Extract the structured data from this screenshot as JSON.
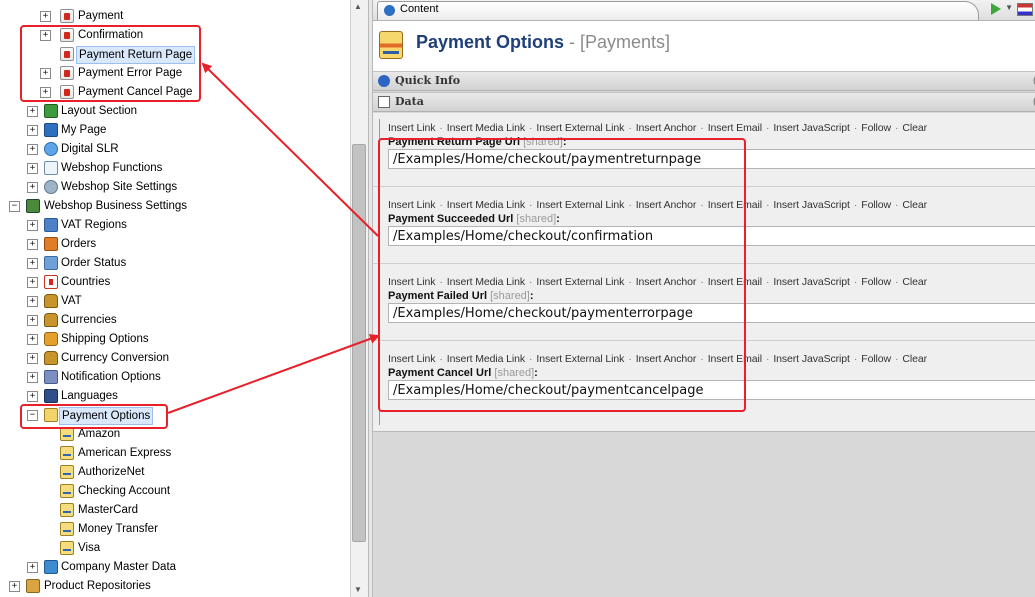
{
  "tree": {
    "items": [
      {
        "label": "Payment",
        "icon": "page-icon"
      },
      {
        "label": "Confirmation",
        "icon": "page-icon"
      },
      {
        "label": "Payment Return Page",
        "icon": "page-icon"
      },
      {
        "label": "Payment Error Page",
        "icon": "page-icon"
      },
      {
        "label": "Payment Cancel Page",
        "icon": "page-icon"
      },
      {
        "label": "Layout Section",
        "icon": "layout-icon"
      },
      {
        "label": "My Page",
        "icon": "grid-icon"
      },
      {
        "label": "Digital SLR",
        "icon": "camera-icon"
      },
      {
        "label": "Webshop Functions",
        "icon": "function-icon"
      },
      {
        "label": "Webshop Site Settings",
        "icon": "gear-icon"
      },
      {
        "label": "Webshop Business Settings",
        "icon": "business-icon"
      },
      {
        "label": "VAT Regions",
        "icon": "region-icon"
      },
      {
        "label": "Orders",
        "icon": "orders-icon"
      },
      {
        "label": "Order Status",
        "icon": "hourglass-icon"
      },
      {
        "label": "Countries",
        "icon": "flag-icon"
      },
      {
        "label": "VAT",
        "icon": "money-bag-icon"
      },
      {
        "label": "Currencies",
        "icon": "money-bag-icon"
      },
      {
        "label": "Shipping Options",
        "icon": "shipping-icon"
      },
      {
        "label": "Currency Conversion",
        "icon": "money-bag-icon"
      },
      {
        "label": "Notification Options",
        "icon": "notification-icon"
      },
      {
        "label": "Languages",
        "icon": "language-icon"
      },
      {
        "label": "Payment Options",
        "icon": "payment-icon"
      },
      {
        "label": "Amazon",
        "icon": "card-icon"
      },
      {
        "label": "American Express",
        "icon": "card-icon"
      },
      {
        "label": "AuthorizeNet",
        "icon": "card-icon"
      },
      {
        "label": "Checking Account",
        "icon": "card-icon"
      },
      {
        "label": "MasterCard",
        "icon": "card-icon"
      },
      {
        "label": "Money Transfer",
        "icon": "card-icon"
      },
      {
        "label": "Visa",
        "icon": "card-icon"
      },
      {
        "label": "Company Master Data",
        "icon": "company-icon"
      },
      {
        "label": "Product Repositories",
        "icon": "box-icon"
      }
    ]
  },
  "tab": {
    "label": "Content"
  },
  "header": {
    "title": "Payment Options",
    "subtitle": " - [Payments]"
  },
  "sections": {
    "quick_info": "Quick Info",
    "data": "Data"
  },
  "toolbar_links": [
    "Insert Link",
    "Insert Media Link",
    "Insert External Link",
    "Insert Anchor",
    "Insert Email",
    "Insert JavaScript",
    "Follow",
    "Clear"
  ],
  "fields": [
    {
      "label": "Payment Return Page Url",
      "shared": "[shared]",
      "value": "/Examples/Home/checkout/paymentreturnpage"
    },
    {
      "label": "Payment Succeeded Url",
      "shared": "[shared]",
      "value": "/Examples/Home/checkout/confirmation"
    },
    {
      "label": "Payment Failed Url",
      "shared": "[shared]",
      "value": "/Examples/Home/checkout/paymenterrorpage"
    },
    {
      "label": "Payment Cancel Url",
      "shared": "[shared]",
      "value": "/Examples/Home/checkout/paymentcancelpage"
    }
  ],
  "colors": {
    "annotation": "#e8202a",
    "title": "#1f3f7a",
    "selection": "#d9e8fb"
  }
}
